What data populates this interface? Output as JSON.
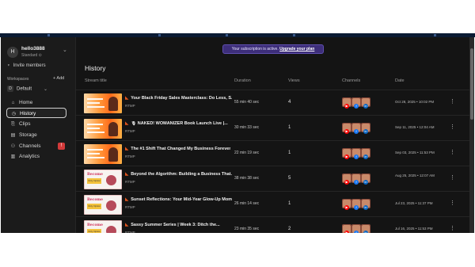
{
  "account": {
    "initial": "H",
    "name": "hello3888",
    "plan": "Standard ⊙"
  },
  "sidebar": {
    "invite_label": "Invite members",
    "workspaces_label": "Workspaces",
    "add_label": "+ Add",
    "workspace": {
      "badge": "D",
      "name": "Default"
    },
    "items": [
      {
        "label": "Home",
        "icon": "home-icon",
        "glyph": "⌂",
        "active": false
      },
      {
        "label": "History",
        "icon": "history-icon",
        "glyph": "◷",
        "active": true
      },
      {
        "label": "Clips",
        "icon": "clips-icon",
        "glyph": "⎘",
        "active": false
      },
      {
        "label": "Storage",
        "icon": "storage-icon",
        "glyph": "▤",
        "active": false
      },
      {
        "label": "Channels",
        "icon": "channels-icon",
        "glyph": "⚇",
        "active": false,
        "warning": "!"
      },
      {
        "label": "Analytics",
        "icon": "analytics-icon",
        "glyph": "▥",
        "active": false
      }
    ]
  },
  "banner": {
    "text": "Your subscription is active.",
    "link": "Upgrade your plan"
  },
  "page_title": "History",
  "table": {
    "headers": {
      "title": "Stream title",
      "duration": "Duration",
      "views": "Views",
      "channels": "Channels",
      "date": "Date"
    },
    "rows": [
      {
        "title": "Your Black Friday Sales Masterclass: Do Less, S...",
        "source": "RTMP",
        "duration": "55 min 40 sec",
        "views": "4",
        "date": "Oct 28, 2025 • 10:02 PM",
        "thumb": "orange"
      },
      {
        "title": "🎙 NAKED! WOMANIZER Book Launch Live |...",
        "source": "RTMP",
        "duration": "30 min 33 sec",
        "views": "1",
        "date": "Sep 11, 2025 • 12:04 AM",
        "thumb": "orange"
      },
      {
        "title": "The #1 Shift That Changed My Business Forever",
        "source": "RTMP",
        "duration": "22 min 19 sec",
        "views": "1",
        "date": "Sep 03, 2025 • 11:53 PM",
        "thumb": "orange"
      },
      {
        "title": "Beyond the Algorithm: Building a Business That...",
        "source": "RTMP",
        "duration": "38 min 38 sec",
        "views": "5",
        "date": "Aug 25, 2025 • 12:07 AM",
        "thumb": "white"
      },
      {
        "title": "Sunset Reflections: Your Mid-Year Glow-Up Moment",
        "source": "RTMP",
        "duration": "26 min 14 sec",
        "views": "1",
        "date": "Jul 23, 2025 • 11:37 PM",
        "thumb": "white"
      },
      {
        "title": "Sassy Summer Series | Week 3: Ditch the...",
        "source": "RTMP",
        "duration": "23 min 35 sec",
        "views": "2",
        "date": "Jul 16, 2025 • 11:53 PM",
        "thumb": "white"
      }
    ],
    "thumb_text": {
      "line1": "Become",
      "line2": "Only Option"
    },
    "more_glyph": "⋮"
  },
  "colors": {
    "accent": "#5f4fb0",
    "background": "#141414",
    "sidebar": "#1b1b1b",
    "warning": "#d23a3a"
  }
}
